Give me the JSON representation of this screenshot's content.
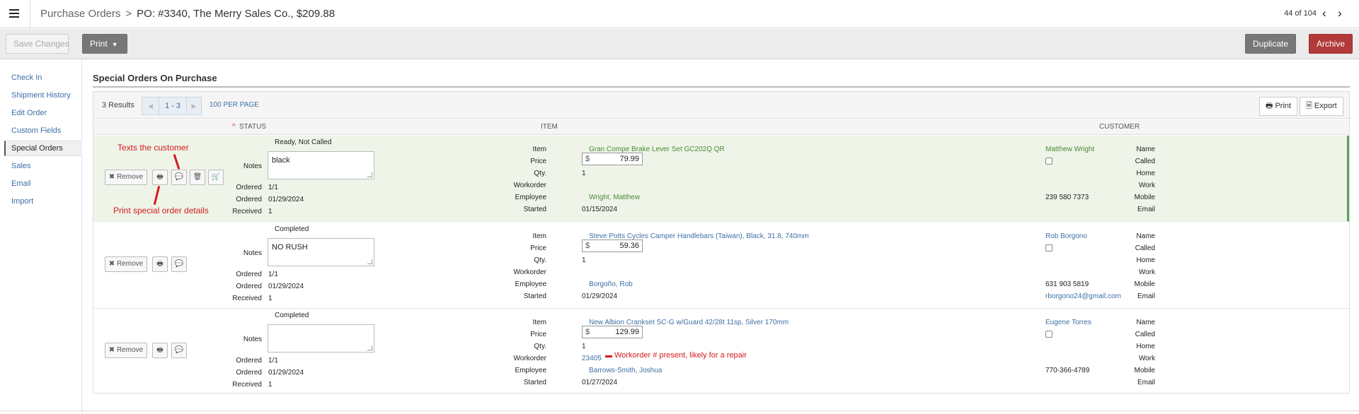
{
  "header": {
    "breadcrumb_link": "Purchase Orders",
    "breadcrumb_sep": ">",
    "title": "PO: #3340, The Merry Sales Co., $209.88",
    "record_position": "44 of 104",
    "prev_icon": "‹",
    "next_icon": "›"
  },
  "toolbar": {
    "save_label": "Save Changes",
    "print_label": "Print",
    "duplicate_label": "Duplicate",
    "archive_label": "Archive"
  },
  "sidebar": {
    "items": [
      {
        "label": "Check In"
      },
      {
        "label": "Shipment History"
      },
      {
        "label": "Edit Order"
      },
      {
        "label": "Custom Fields"
      },
      {
        "label": "Special Orders"
      },
      {
        "label": "Sales"
      },
      {
        "label": "Email"
      },
      {
        "label": "Import"
      }
    ],
    "active_index": 4
  },
  "section": {
    "title": "Special Orders On Purchase"
  },
  "results": {
    "count_text": "3 Results",
    "page_range": "1 - 3",
    "per_page": "100 PER PAGE",
    "print_label": "Print",
    "export_label": "Export"
  },
  "columns": {
    "status": "STATUS",
    "item": "ITEM",
    "customer": "CUSTOMER"
  },
  "labels": {
    "remove": "Remove",
    "notes": "Notes",
    "ordered": "Ordered",
    "received": "Received",
    "item": "Item",
    "price": "Price",
    "qty": "Qty.",
    "workorder": "Workorder",
    "employee": "Employee",
    "started": "Started",
    "name": "Name",
    "called": "Called",
    "home": "Home",
    "work": "Work",
    "mobile": "Mobile",
    "email": "Email",
    "currency": "$"
  },
  "orders": [
    {
      "status": "Ready, Not Called",
      "notes": "black",
      "ordered_qty": "1/1",
      "ordered_date": "01/29/2024",
      "received": "1",
      "item": "Gran Compe Brake Lever Set GC202Q QR",
      "price": "79.99",
      "qty": "1",
      "workorder": "",
      "employee": "Wright, Matthew",
      "started": "01/15/2024",
      "customer_name": "Matthew Wright",
      "home": "",
      "work": "",
      "mobile": "239 580 7373",
      "email": ""
    },
    {
      "status": "Completed",
      "notes": "NO RUSH",
      "ordered_qty": "1/1",
      "ordered_date": "01/29/2024",
      "received": "1",
      "item": "Steve Potts Cycles Camper Handlebars (Taiwan), Black, 31.8, 740mm",
      "price": "59.36",
      "qty": "1",
      "workorder": "",
      "employee": "Borgoño, Rob",
      "started": "01/29/2024",
      "customer_name": "Rob Borgono",
      "home": "",
      "work": "",
      "mobile": "631 903 5819",
      "email": "rborgono24@gmail.com"
    },
    {
      "status": "Completed",
      "notes": "",
      "ordered_qty": "1/1",
      "ordered_date": "01/29/2024",
      "received": "1",
      "item": "New Albion Crankset SC-G w/Guard 42/28t 11sp, Silver 170mm",
      "price": "129.99",
      "qty": "1",
      "workorder": "23405",
      "employee": "Barrows-Smith, Joshua",
      "started": "01/27/2024",
      "customer_name": "Eugene Torres",
      "home": "",
      "work": "",
      "mobile": "770-366-4789",
      "email": ""
    }
  ],
  "annotations": {
    "texts_customer": "Texts the customer",
    "print_details": "Print special order details",
    "workorder_note": "Workorder # present, likely for a repair"
  },
  "colors": {
    "highlight_row": "#eef4e8",
    "highlight_border": "#5aa255",
    "archive": "#b33a3a",
    "annotation": "#d41a1a",
    "link": "#3d6fa6"
  }
}
